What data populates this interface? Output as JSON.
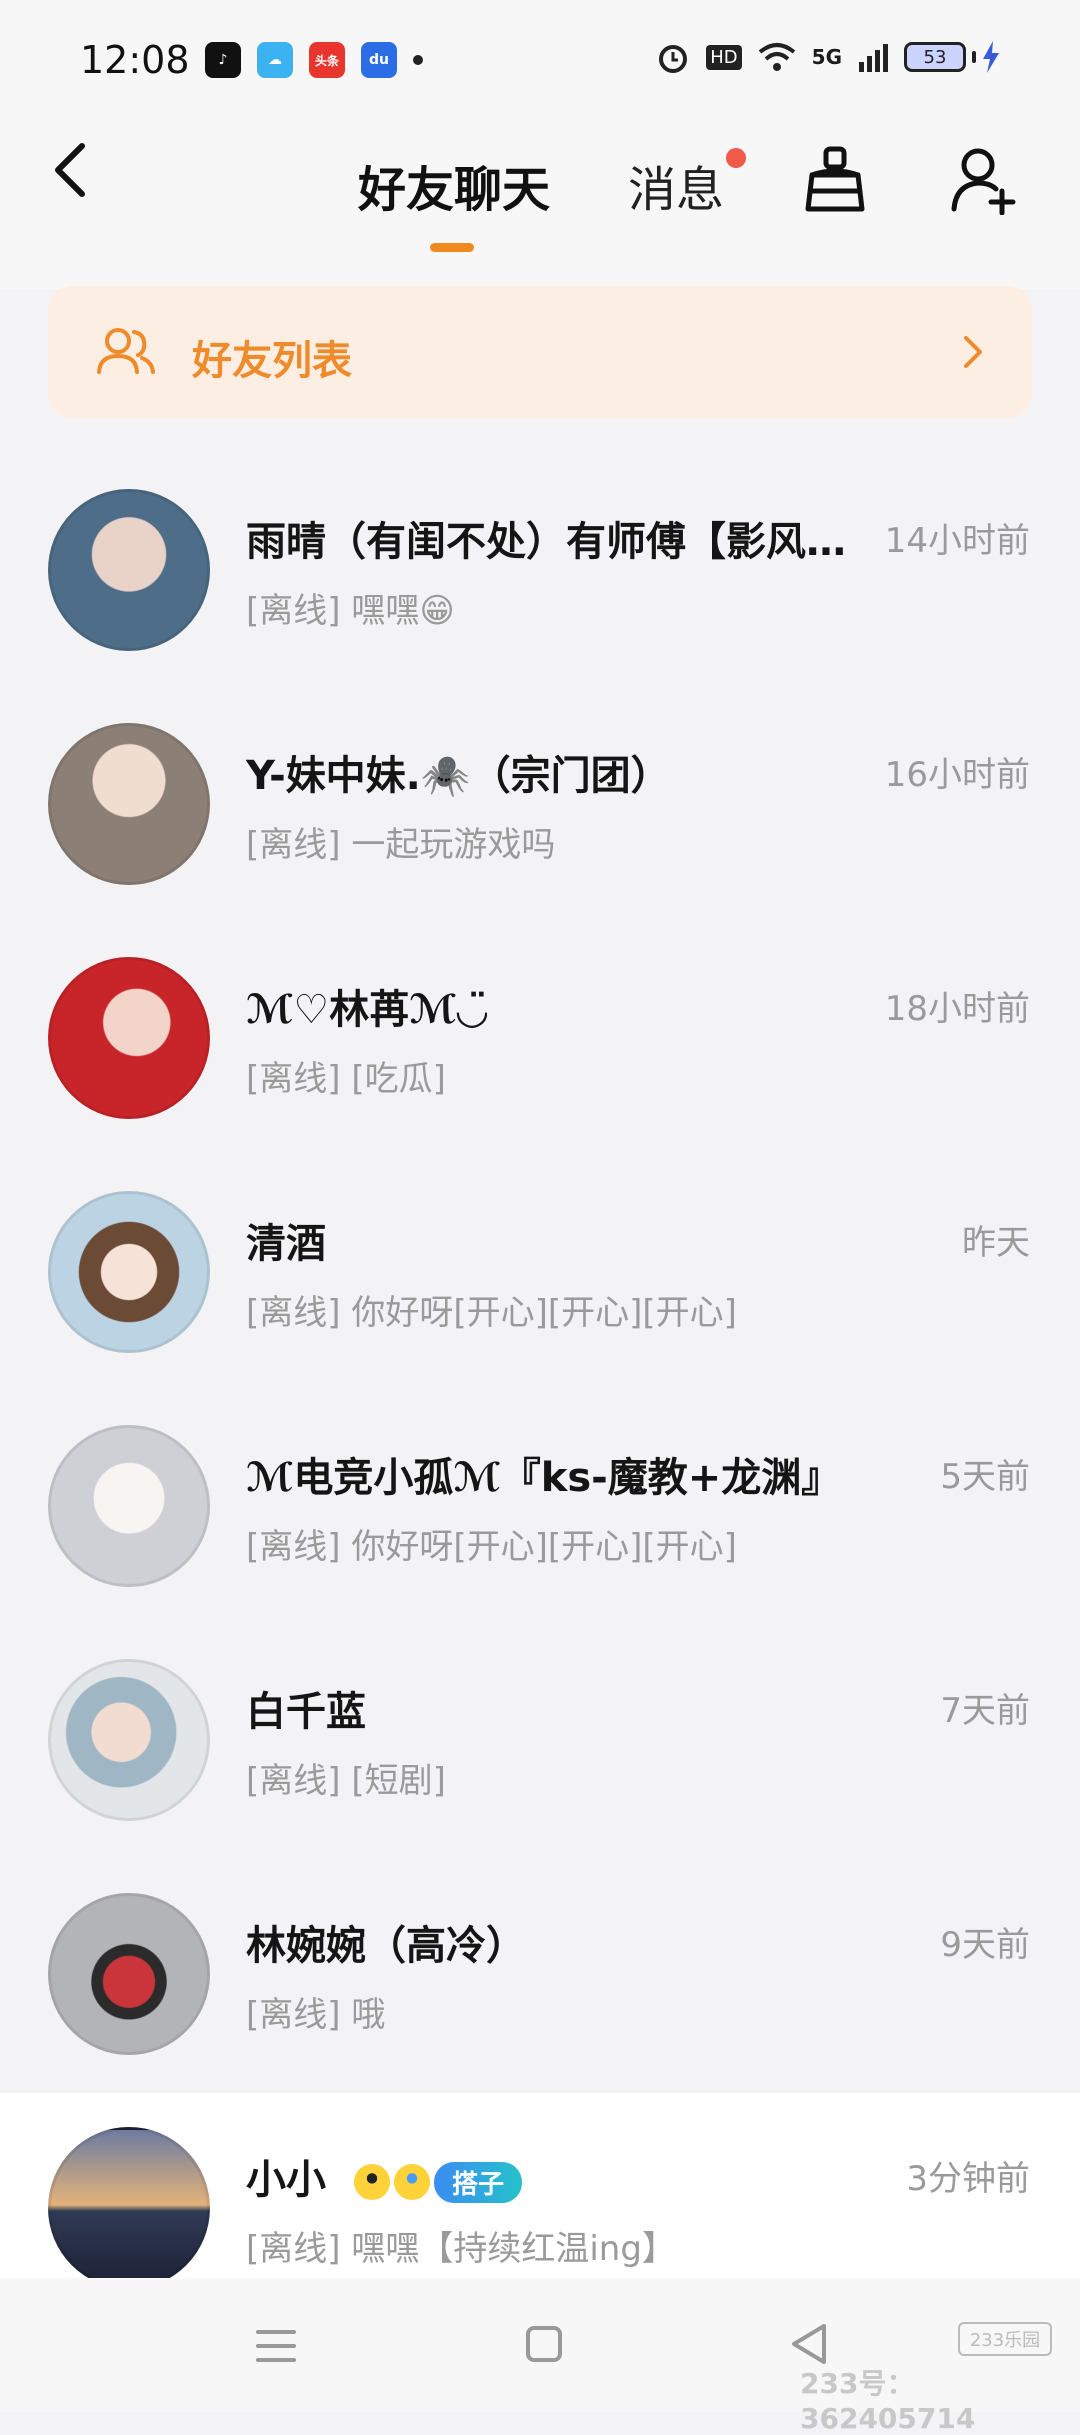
{
  "status_bar": {
    "time": "12:08",
    "apps": [
      {
        "name": "douyin",
        "label": "♪",
        "color": "#111111"
      },
      {
        "name": "weather",
        "label": "☁",
        "color": "#3cb3f0"
      },
      {
        "name": "toutiao",
        "label": "头条",
        "color": "#e8362f"
      },
      {
        "name": "baidu",
        "label": "du",
        "color": "#2b6de5"
      }
    ],
    "network": "5G",
    "hd": "HD",
    "battery": "53"
  },
  "header": {
    "tab_friends": "好友聊天",
    "tab_messages": "消息",
    "active_tab": "好友聊天"
  },
  "friend_list": {
    "label": "好友列表"
  },
  "conversations": [
    {
      "name": "雨晴（有闺不处）有师傅【影风…",
      "time": "14小时前",
      "message": "[离线] 嘿嘿😁",
      "avatar_color": "#5e7a93"
    },
    {
      "name": "Y-妹中妹.🕷️（宗门团）",
      "time": "16小时前",
      "message": "[离线] 一起玩游戏吗",
      "avatar_color": "#8b7f76"
    },
    {
      "name": "ℳ♡林苒ℳ◡̈",
      "time": "18小时前",
      "message": "[离线] [吃瓜]",
      "avatar_color": "#c8252b"
    },
    {
      "name": "清酒",
      "time": "昨天",
      "message": "[离线] 你好呀[开心][开心][开心]",
      "avatar_color": "#caa46a"
    },
    {
      "name": "ℳ电竞小孤ℳ『ks-魔教+龙渊』",
      "time": "5天前",
      "message": "[离线] 你好呀[开心][开心][开心]",
      "avatar_color": "#d9d9dd"
    },
    {
      "name": "白千蓝",
      "time": "7天前",
      "message": "[离线] [短剧]",
      "avatar_color": "#bcc9cf"
    },
    {
      "name": "林婉婉（高冷）",
      "time": "9天前",
      "message": "[离线] 哦",
      "avatar_color": "#a8a9ab"
    },
    {
      "name": "小小",
      "time": "3分钟前",
      "message": "[离线] 嘿嘿【持续红温ing】",
      "avatar_color": "#4d5a79",
      "tag": "搭子"
    }
  ],
  "watermark": {
    "logo": "233乐园",
    "text": "233号：362405714"
  }
}
